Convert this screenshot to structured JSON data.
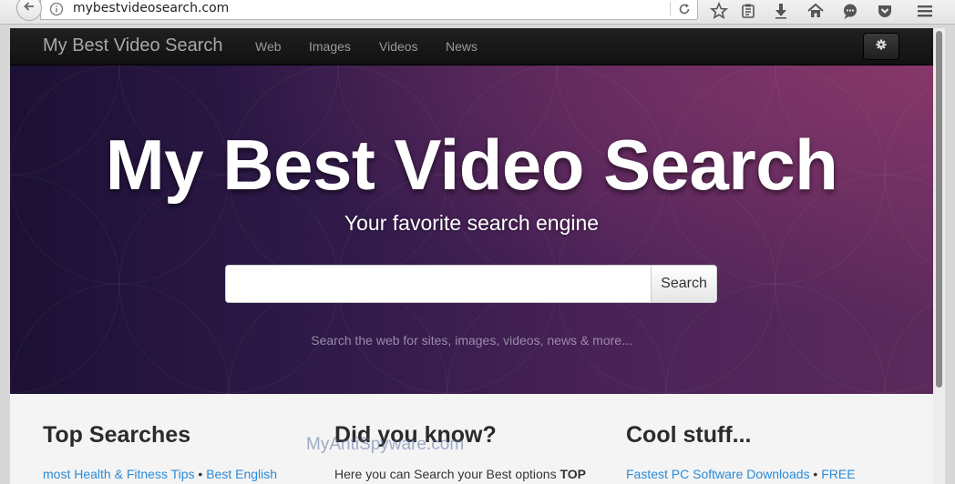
{
  "browser": {
    "url": "mybestvideosearch.com"
  },
  "navbar": {
    "brand": "My Best Video Search",
    "links": [
      "Web",
      "Images",
      "Videos",
      "News"
    ]
  },
  "hero": {
    "title": "My Best Video Search",
    "subtitle": "Your favorite search engine",
    "search_button": "Search",
    "search_placeholder": "",
    "hint": "Search the web for sites, images, videos, news & more..."
  },
  "columns": [
    {
      "heading": "Top Searches",
      "text_link1": "most Health & Fitness Tips",
      "sep": " • ",
      "text_link2": "Best English"
    },
    {
      "heading": "Did you know?",
      "text_plain": "Here you can Search your Best options ",
      "text_bold": "TOP"
    },
    {
      "heading": "Cool stuff...",
      "text_link1": "Fastest PC Software Downloads",
      "sep": " • ",
      "text_link2": "FREE"
    }
  ],
  "watermark": "MyAntiSpyware.com",
  "colors": {
    "link": "#2b8ad8",
    "navbar": "#151515",
    "hero_start": "#1c1035",
    "hero_end": "#5c2a5c"
  }
}
